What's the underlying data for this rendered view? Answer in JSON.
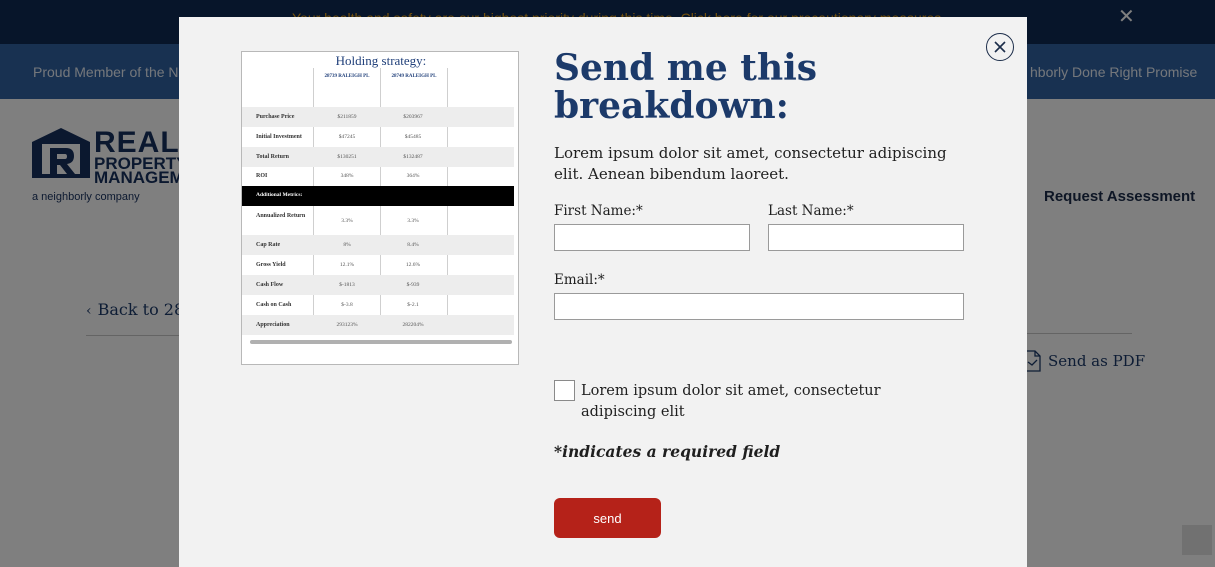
{
  "colors": {
    "alert_bg": "#0e2a55",
    "alert_text": "#e8a21a",
    "member_bar_bg": "#3163a3",
    "brand_navy": "#1c3a6a",
    "send_button": "#b52219",
    "modal_bg": "#f2f2f2"
  },
  "alert_bar": {
    "text": "Your health and safety are our highest priority during this time. Click here for our precautionary measures.",
    "close_icon": "close-x-icon"
  },
  "member_bar": {
    "left_text": "Proud Member of the Ne",
    "right_text": "hborly Done Right Promise"
  },
  "header": {
    "logo": {
      "line1": "REAL",
      "line2": "PROPERTY",
      "line3": "MANAGEMENT",
      "tagline": "a neighborly company"
    },
    "request_assessment": "Request Assessment"
  },
  "page": {
    "back_link": "Back to 28",
    "send_pdf": "Send as PDF",
    "send_pdf_icon": "pdf-send-icon"
  },
  "modal": {
    "close_icon": "close-circle-icon",
    "preview": {
      "title": "Holding strategy:",
      "columns": [
        "28739 RALEIGH PL",
        "28749 RALEIGH PL"
      ],
      "rows": [
        {
          "label": "Purchase Price",
          "v1": "$211859",
          "v2": "$203967"
        },
        {
          "label": "Initial Investment",
          "v1": "$47245",
          "v2": "$45485"
        },
        {
          "label": "Total Return",
          "v1": "$130251",
          "v2": "$132487"
        },
        {
          "label": "ROI",
          "v1": "348%",
          "v2": "364%"
        }
      ],
      "section_header": "Additional Metrics:",
      "metrics": [
        {
          "label": "Annualized Return",
          "v1": "3.3%",
          "v2": "3.3%"
        },
        {
          "label": "Cap Rate",
          "v1": "8%",
          "v2": "8.4%"
        },
        {
          "label": "Gross Yield",
          "v1": "12.1%",
          "v2": "12.6%"
        },
        {
          "label": "Cash Flow",
          "v1": "$-1813",
          "v2": "$-939"
        },
        {
          "label": "Cash on Cash",
          "v1": "$-3.8",
          "v2": "$-2.1"
        },
        {
          "label": "Appreciation",
          "v1": "293123%",
          "v2": "282204%"
        }
      ]
    },
    "form": {
      "title": "Send me this breakdown:",
      "description": "Lorem ipsum dolor sit amet, consectetur adipiscing elit. Aenean bibendum laoreet.",
      "first_name_label": "First Name:*",
      "last_name_label": "Last Name:*",
      "email_label": "Email:*",
      "first_name_value": "",
      "last_name_value": "",
      "email_value": "",
      "checkbox_label": "Lorem ipsum dolor sit amet, consectetur adipiscing elit",
      "checkbox_checked": false,
      "required_note": "*indicates a required field",
      "send_label": "send"
    }
  }
}
